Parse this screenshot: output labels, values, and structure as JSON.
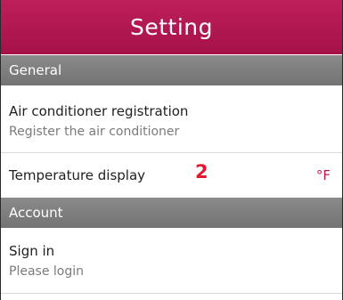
{
  "header": {
    "title": "Setting"
  },
  "sections": {
    "general": {
      "label": "General",
      "items": {
        "ac_registration": {
          "title": "Air conditioner registration",
          "subtitle": "Register the air conditioner"
        },
        "temperature_display": {
          "title": "Temperature display",
          "marker": "2",
          "value": "°F"
        }
      }
    },
    "account": {
      "label": "Account",
      "items": {
        "sign_in": {
          "title": "Sign in",
          "subtitle": "Please login"
        }
      }
    }
  },
  "colors": {
    "header_bg": "#b0174f",
    "section_bg": "#808080",
    "unit_accent": "#c4154f",
    "marker_red": "#e4192c"
  }
}
